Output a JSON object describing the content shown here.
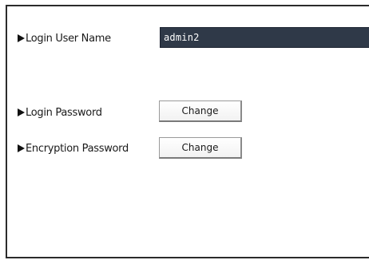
{
  "login_user_name": {
    "label": "Login User Name",
    "value": "admin2"
  },
  "login_password": {
    "label": "Login Password",
    "button_label": "Change"
  },
  "encryption_password": {
    "label": "Encryption Password",
    "button_label": "Change"
  },
  "colors": {
    "field_background": "#2f3948",
    "field_text": "#ffffff",
    "frame_border": "#2b2b2b"
  }
}
